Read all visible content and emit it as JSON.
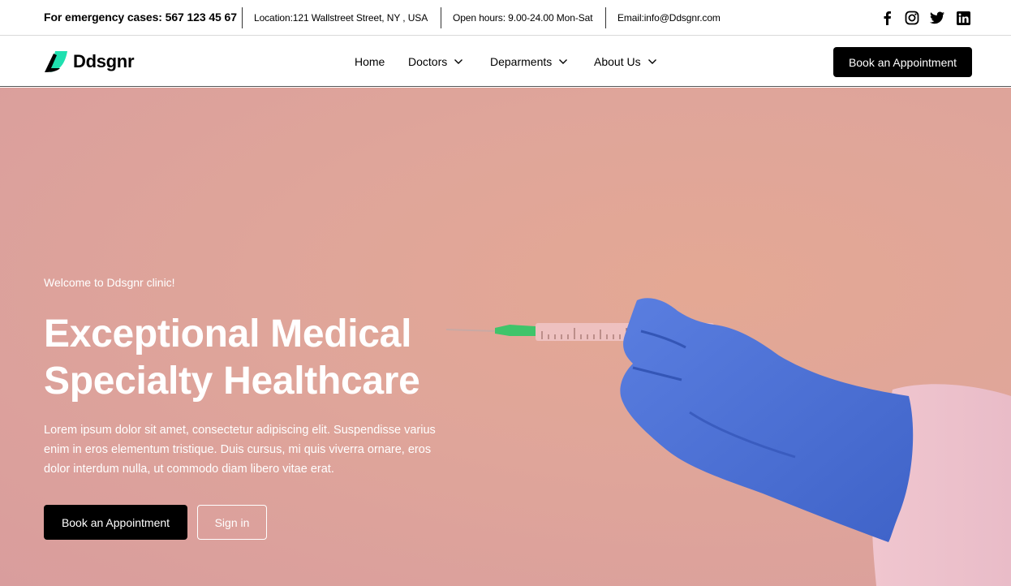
{
  "topbar": {
    "emergency": "For emergency cases: 567 123 45 67",
    "location": "Location:121 Wallstreet Street, NY , USA",
    "hours": "Open hours: 9.00-24.00 Mon-Sat",
    "email": "Email:info@Ddsgnr.com",
    "social": [
      "facebook-icon",
      "instagram-icon",
      "twitter-icon",
      "linkedin-icon"
    ]
  },
  "nav": {
    "logo_text": "Ddsgnr",
    "items": [
      {
        "label": "Home"
      },
      {
        "label": "Doctors"
      },
      {
        "label": "Deparments"
      },
      {
        "label": "About Us"
      }
    ],
    "cta": "Book an Appointment"
  },
  "hero": {
    "welcome": "Welcome to Ddsgnr clinic!",
    "headline_line1": "Exceptional Medical",
    "headline_line2": "Specialty Healthcare",
    "description": "Lorem ipsum dolor sit amet, consectetur adipiscing elit. Suspendisse varius enim in eros elementum tristique. Duis cursus, mi quis viverra ornare, eros dolor interdum nulla, ut commodo diam libero vitae erat.",
    "primary_button": "Book an Appointment",
    "secondary_button": "Sign in"
  },
  "colors": {
    "accent": "#1fe0b0",
    "hero_bg": "#e1a697",
    "glove": "#4a6fd1",
    "button_dark": "#000000"
  }
}
